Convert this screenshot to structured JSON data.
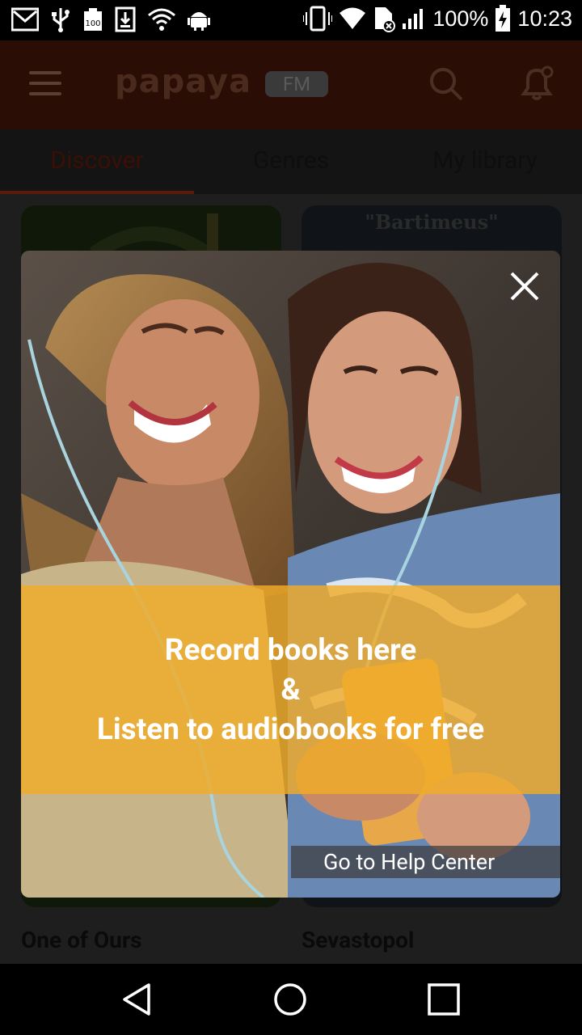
{
  "status_bar": {
    "icons_left": [
      "gmail-icon",
      "usb-icon",
      "battery-100-icon",
      "download-icon",
      "wifi-outline-icon",
      "android-icon"
    ],
    "battery_percent": "100%",
    "time": "10:23",
    "icons_right": [
      "vibrate-icon",
      "wifi-icon",
      "no-sim-icon",
      "signal-icon",
      "battery-charging-icon"
    ]
  },
  "app_bar": {
    "logo": "papaya",
    "logo_badge": "FM"
  },
  "tabs": [
    {
      "label": "Discover",
      "active": true
    },
    {
      "label": "Genres",
      "active": false
    },
    {
      "label": "My library",
      "active": false
    }
  ],
  "books": [
    {
      "title": "One of Ours"
    },
    {
      "title": "Sevastopol",
      "cover_text": "\"Bartimeus\""
    }
  ],
  "popup": {
    "line1": "Record books here",
    "line2": "&",
    "line3": "Listen to audiobooks for free",
    "help_link": "Go to Help Center",
    "banner_color": "#F0AC28"
  },
  "colors": {
    "app_bar": "#2A0D04",
    "tab_indicator": "#5A1B0C"
  }
}
